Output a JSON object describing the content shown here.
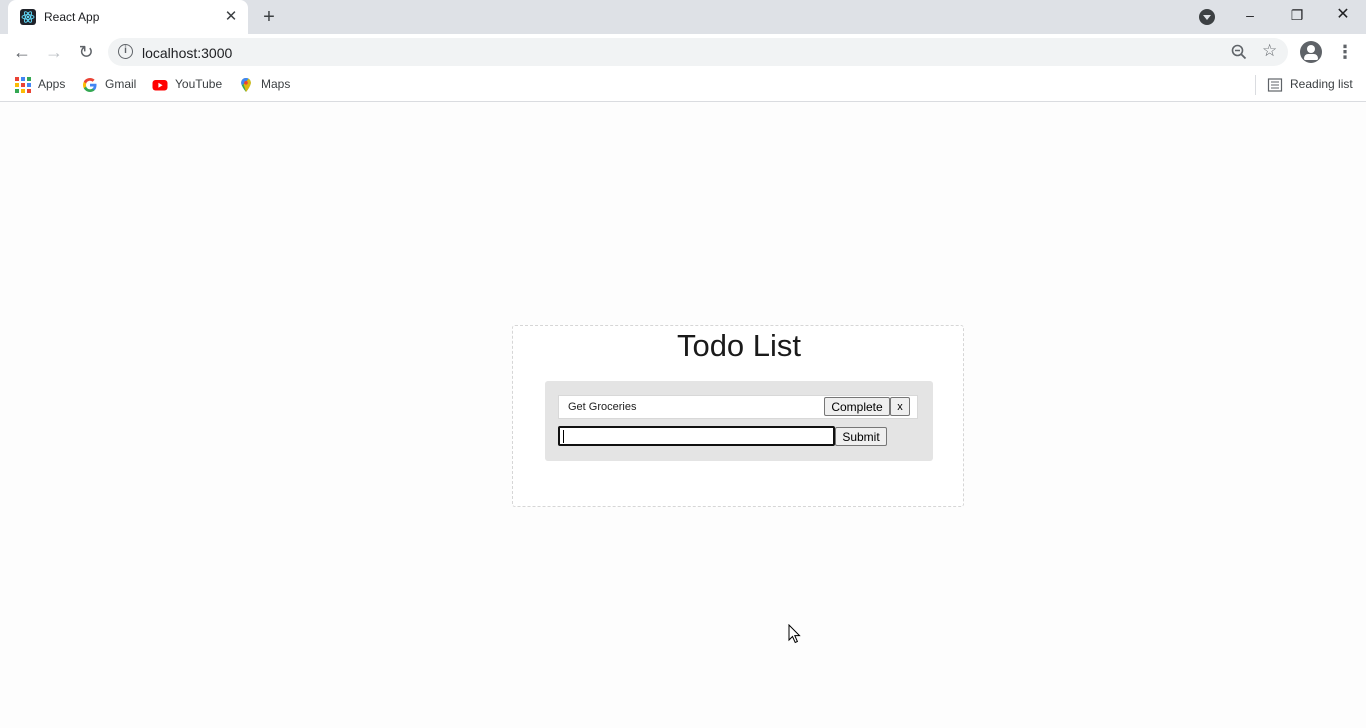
{
  "browser": {
    "tab_title": "React App",
    "tab_close": "✕",
    "new_tab": "+",
    "url": "localhost:3000",
    "window_minimize": "–",
    "window_restore": "❐",
    "window_close": "✕"
  },
  "bookmarks": {
    "items": [
      {
        "label": "Apps",
        "icon": "apps-grid-icon"
      },
      {
        "label": "Gmail",
        "icon": "google-icon"
      },
      {
        "label": "YouTube",
        "icon": "youtube-icon"
      },
      {
        "label": "Maps",
        "icon": "maps-pin-icon"
      }
    ],
    "reading_list": "Reading list"
  },
  "app": {
    "title": "Todo List",
    "todos": [
      {
        "text": "Get Groceries",
        "complete_label": "Complete",
        "remove_label": "x"
      }
    ],
    "input_value": "",
    "submit_label": "Submit"
  },
  "colors": {
    "tab_strip": "#dee1e6",
    "omnibox": "#f1f3f4",
    "panel": "#e4e4e4",
    "youtube_red": "#ff0000"
  }
}
